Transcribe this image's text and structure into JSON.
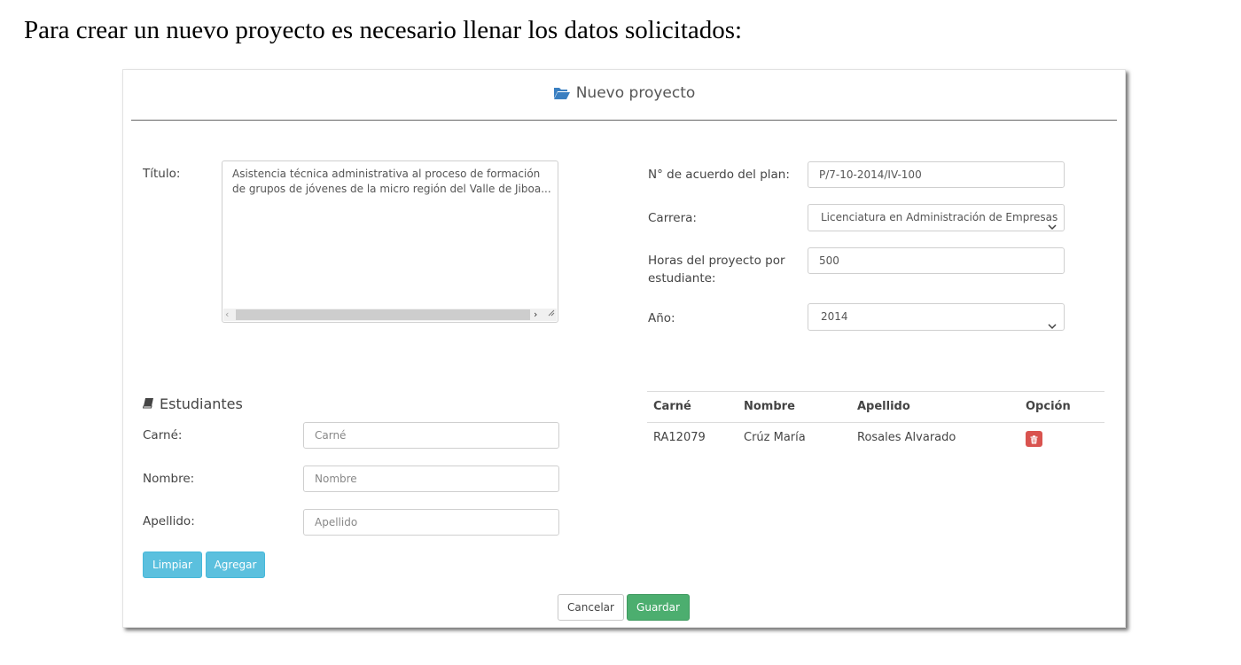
{
  "doc": {
    "intro": "Para crear un nuevo proyecto es necesario llenar los datos solicitados:"
  },
  "panel": {
    "title": "Nuevo proyecto",
    "title_icon": "folder-open-icon"
  },
  "form": {
    "titulo_label": "Título:",
    "titulo_value": "Asistencia técnica administrativa al proceso de formación de grupos de jóvenes de la micro región del Valle de Jiboa...",
    "acuerdo_label": "N° de acuerdo del plan:",
    "acuerdo_value": "P/7-10-2014/IV-100",
    "carrera_label": "Carrera:",
    "carrera_value": "Licenciatura en Administración de Empresas",
    "horas_label_1": "Horas del proyecto por",
    "horas_label_2": "estudiante:",
    "horas_value": "500",
    "anio_label": "Año:",
    "anio_value": "2014"
  },
  "students": {
    "section_title": "Estudiantes",
    "section_icon": "book-icon",
    "carne_label": "Carné:",
    "carne_placeholder": "Carné",
    "nombre_label": "Nombre:",
    "nombre_placeholder": "Nombre",
    "apellido_label": "Apellido:",
    "apellido_placeholder": "Apellido",
    "limpiar_label": "Limpiar",
    "agregar_label": "Agregar"
  },
  "table": {
    "headers": [
      "Carné",
      "Nombre",
      "Apellido",
      "Opción"
    ],
    "rows": [
      {
        "carne": "RA12079",
        "nombre": "Crúz María",
        "apellido": "Rosales Alvarado",
        "option_icon": "trash-icon"
      }
    ]
  },
  "actions": {
    "cancel_label": "Cancelar",
    "save_label": "Guardar"
  },
  "colors": {
    "info": "#5bc0de",
    "success": "#4cae6f",
    "danger": "#d9534f",
    "icon_blue": "#3a7fc1"
  }
}
